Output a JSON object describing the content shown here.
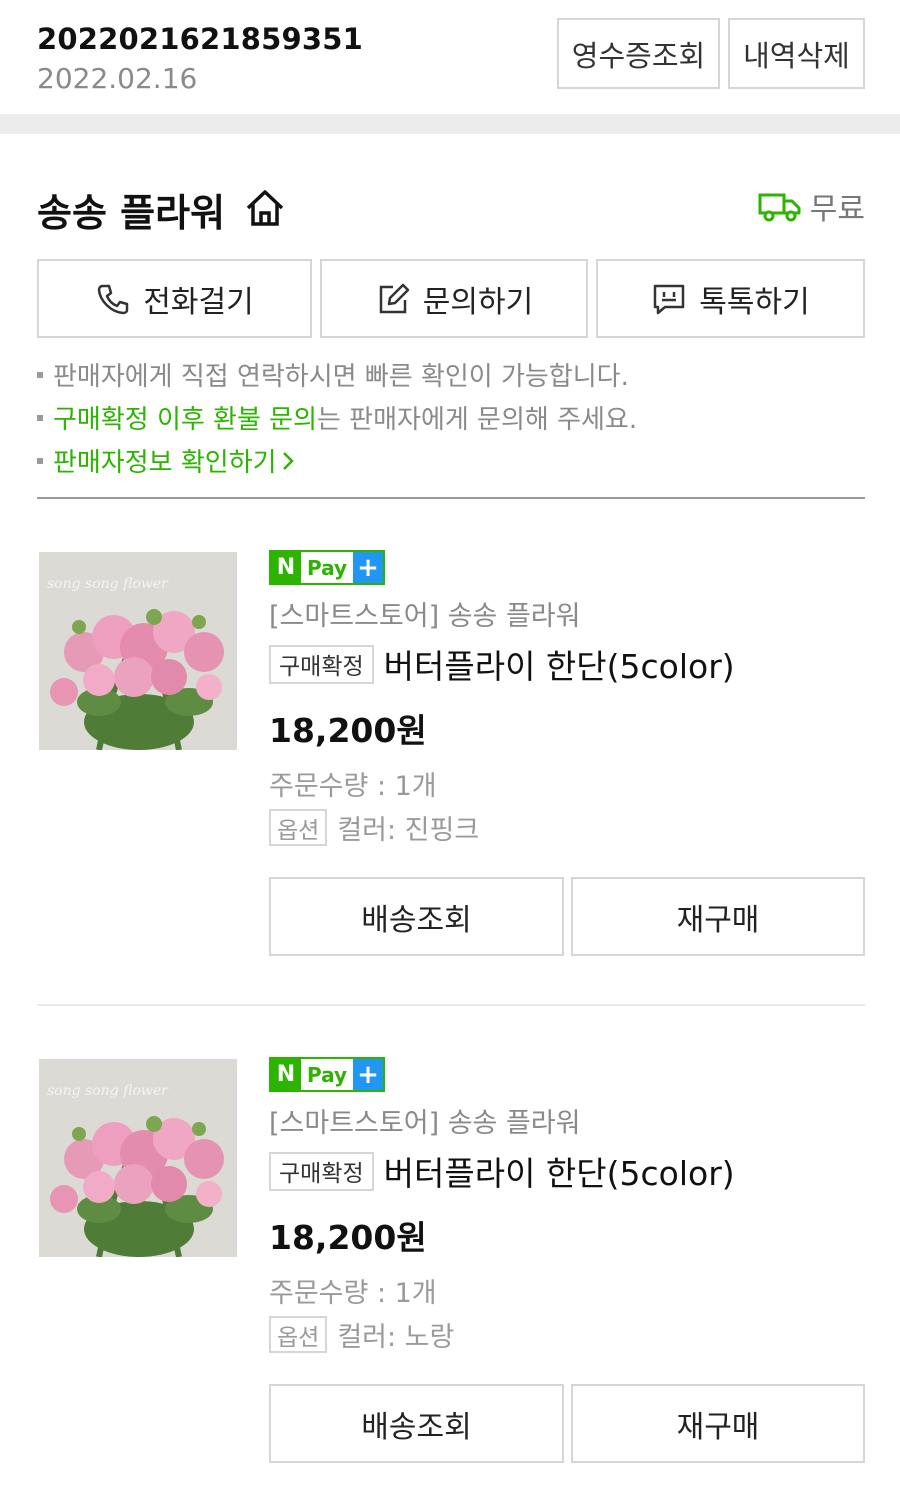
{
  "order": {
    "number": "2022021621859351",
    "date": "2022.02.16",
    "receipt_label": "영수증조회",
    "delete_label": "내역삭제"
  },
  "store": {
    "name": "송송 플라워",
    "shipping_label": "무료"
  },
  "contact": {
    "call_label": "전화걸기",
    "inquiry_label": "문의하기",
    "talk_label": "톡톡하기"
  },
  "notices": {
    "line1": "판매자에게 직접 연락하시면 빠른 확인이 가능합니다.",
    "line2_green": "구매확정 이후 환불 문의",
    "line2_rest": "는 판매자에게 문의해 주세요.",
    "line3": "판매자정보 확인하기"
  },
  "colors": {
    "accent_green": "#2db400",
    "npay_plus_blue": "#2196f3"
  },
  "items": [
    {
      "badge_n": "N",
      "badge_pay": "Pay",
      "badge_plus": "+",
      "seller": "[스마트스토어] 송송 플라워",
      "status": "구매확정",
      "name": "버터플라이 한단(5color)",
      "price": "18,200원",
      "qty": "주문수량 : 1개",
      "option_badge": "옵션",
      "option": "컬러: 진핑크",
      "image_watermark": "song song flower",
      "btn_track": "배송조회",
      "btn_rebuy": "재구매"
    },
    {
      "badge_n": "N",
      "badge_pay": "Pay",
      "badge_plus": "+",
      "seller": "[스마트스토어] 송송 플라워",
      "status": "구매확정",
      "name": "버터플라이 한단(5color)",
      "price": "18,200원",
      "qty": "주문수량 : 1개",
      "option_badge": "옵션",
      "option": "컬러: 노랑",
      "image_watermark": "song song flower",
      "btn_track": "배송조회",
      "btn_rebuy": "재구매"
    }
  ]
}
